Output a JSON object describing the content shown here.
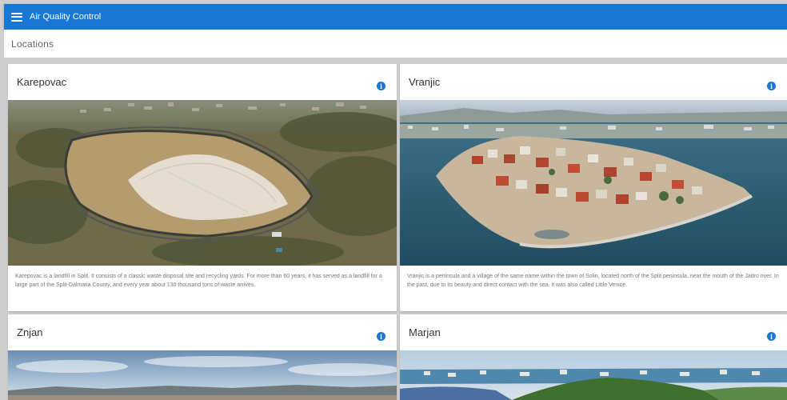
{
  "app": {
    "title": "Air Quality Control",
    "menu_icon": "hamburger-menu-icon"
  },
  "page": {
    "title": "Locations"
  },
  "locations": [
    {
      "name": "Karepovac",
      "description": "Karepovac is a landfill in Split. It consists of a classic waste disposal site and recycling yards. For more than 60 years, it has served as a landfill for a large part of the Split-Dalmatia County, and every year about 130 thousand tons of waste arrives.",
      "info_icon": "info-icon"
    },
    {
      "name": "Vranjic",
      "description": "Vranjic is a peninsula and a village of the same name within the town of Solin, located north of the Split peninsula, near the mouth of the Jadro river. In the past, due to its beauty and direct contact with the sea, it was also called Little Venice.",
      "info_icon": "info-icon"
    },
    {
      "name": "Znjan",
      "info_icon": "info-icon"
    },
    {
      "name": "Marjan",
      "info_icon": "info-icon"
    }
  ],
  "colors": {
    "primary": "#1976d2",
    "background": "#cfcfcf"
  }
}
